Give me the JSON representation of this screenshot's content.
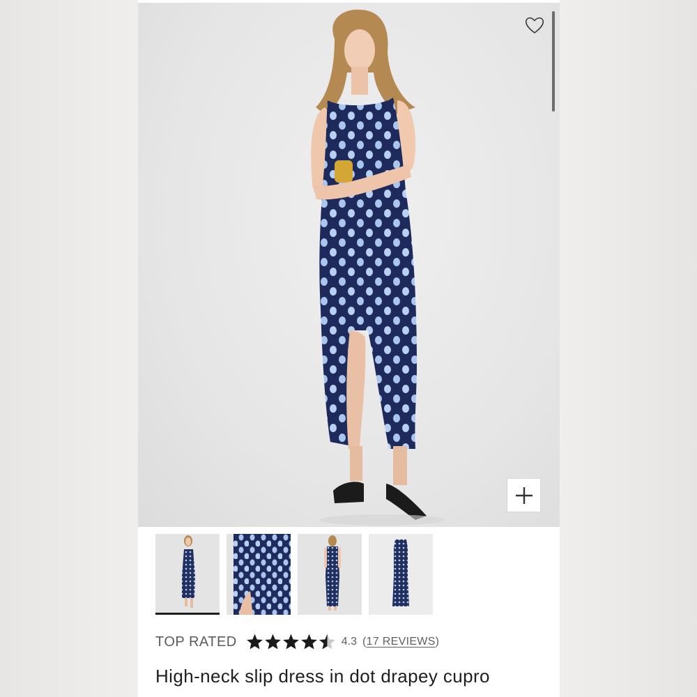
{
  "product": {
    "title": "High-neck slip dress in dot drapey cupro",
    "badge": "TOP RATED",
    "rating_value": "4.3",
    "rating_fraction": 0.86,
    "reviews_open": "(",
    "reviews_link": "17 REVIEWS",
    "reviews_close": ")"
  },
  "icons": {
    "favorite": "heart-icon",
    "zoom": "plus-icon",
    "star_full": "star-icon",
    "star_half": "half-star-icon"
  },
  "gallery": {
    "thumbnails": [
      "front-view",
      "detail-slit-view",
      "back-view",
      "flat-lay-view"
    ],
    "selected_index": 0
  },
  "colors": {
    "dress_navy": "#1f2a5c",
    "dot_blue": "#a9c6ee",
    "text_dark": "#1e1e1e",
    "text_gray": "#5b5b5b"
  }
}
